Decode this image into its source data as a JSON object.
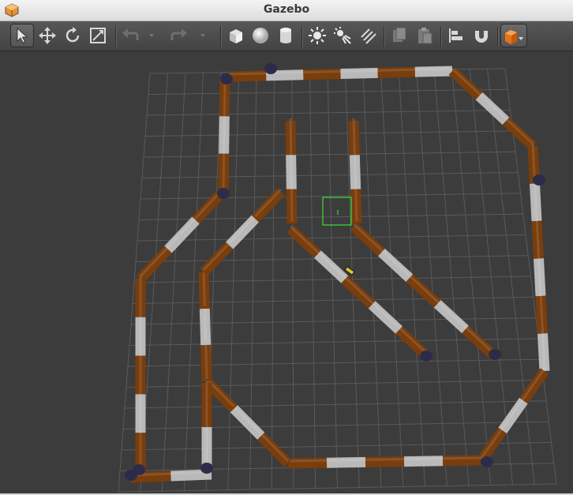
{
  "window": {
    "title": "Gazebo",
    "icon": "gazebo-logo-icon"
  },
  "toolbar": {
    "items": [
      {
        "name": "select-mode-button",
        "icon": "arrow-cursor-icon",
        "active": true
      },
      {
        "name": "translate-mode-button",
        "icon": "move-arrows-icon"
      },
      {
        "name": "rotate-mode-button",
        "icon": "rotate-icon"
      },
      {
        "name": "scale-mode-button",
        "icon": "scale-icon"
      },
      {
        "name": "undo-button",
        "icon": "undo-icon",
        "enabled": false
      },
      {
        "name": "undo-history-button",
        "icon": "chevron-down-icon",
        "enabled": false
      },
      {
        "name": "redo-button",
        "icon": "redo-icon",
        "enabled": false
      },
      {
        "name": "redo-history-button",
        "icon": "chevron-down-icon",
        "enabled": false
      },
      {
        "name": "box-shape-button",
        "icon": "cube-icon"
      },
      {
        "name": "sphere-shape-button",
        "icon": "sphere-icon"
      },
      {
        "name": "cylinder-shape-button",
        "icon": "cylinder-icon"
      },
      {
        "name": "point-light-button",
        "icon": "point-light-icon"
      },
      {
        "name": "spot-light-button",
        "icon": "spot-light-icon"
      },
      {
        "name": "directional-light-button",
        "icon": "directional-light-icon"
      },
      {
        "name": "copy-button",
        "icon": "copy-icon",
        "enabled": false
      },
      {
        "name": "paste-button",
        "icon": "paste-icon",
        "enabled": false
      },
      {
        "name": "align-button",
        "icon": "align-icon"
      },
      {
        "name": "snap-button",
        "icon": "magnet-icon"
      },
      {
        "name": "view-angle-button",
        "icon": "view-cube-icon"
      }
    ]
  },
  "scene": {
    "background_color": "#3c3c3c",
    "grid_color": "#5a5a5a",
    "wall_colors": [
      "#7a3d0c",
      "#b9b9b9"
    ],
    "post_color": "#2c2c4a",
    "selection_color": "#33ff33"
  }
}
